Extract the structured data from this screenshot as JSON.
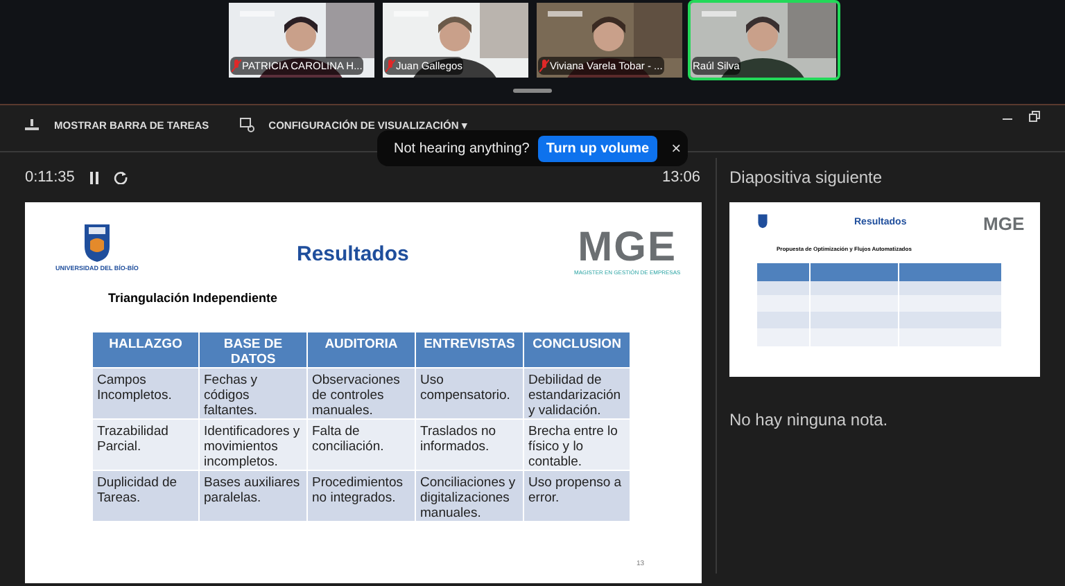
{
  "participants": [
    {
      "name": "PATRICIA CAROLINA H...",
      "muted": true,
      "speaking": false
    },
    {
      "name": "Juan Gallegos",
      "muted": true,
      "speaking": false
    },
    {
      "name": "Viviana Varela Tobar - ...",
      "muted": true,
      "speaking": false
    },
    {
      "name": "Raúl Silva",
      "muted": false,
      "speaking": true
    }
  ],
  "toolbar": [
    "MOSTRAR BARRA DE TAREAS",
    "CONFIGURACIÓN DE VISUALIZACIÓN ▾"
  ],
  "toast": {
    "message": "Not hearing anything?",
    "action": "Turn up volume",
    "close": "×"
  },
  "timer": {
    "elapsed": "0:11:35",
    "clock": "13:06"
  },
  "slide": {
    "university": "UNIVERSIDAD DEL BÍO-BÍO",
    "title": "Resultados",
    "brand": "MGE",
    "brand_tagline": "MAGISTER EN GESTIÓN DE EMPRESAS",
    "subtitle": "Triangulación Independiente",
    "table": {
      "columns": [
        "HALLAZGO",
        "BASE DE DATOS",
        "AUDITORIA",
        "ENTREVISTAS",
        "CONCLUSION"
      ],
      "rows": [
        [
          "Campos Incompletos.",
          "Fechas y códigos faltantes.",
          "Observaciones de controles manuales.",
          "Uso compensatorio.",
          "Debilidad de estandarización y validación."
        ],
        [
          "Trazabilidad Parcial.",
          "Identificadores y movimientos incompletos.",
          "Falta de conciliación.",
          "Traslados no informados.",
          "Brecha entre lo físico y lo contable."
        ],
        [
          "Duplicidad de Tareas.",
          "Bases auxiliares paralelas.",
          "Procedimientos no integrados.",
          "Conciliaciones y digitalizaciones manuales.",
          "Uso propenso a error."
        ]
      ]
    },
    "page": "13"
  },
  "next_slide": {
    "heading": "Diapositiva siguiente",
    "title": "Resultados",
    "brand": "MGE",
    "subtitle": "Propuesta de Optimización y Flujos Automatizados"
  },
  "notes": "No hay ninguna nota."
}
